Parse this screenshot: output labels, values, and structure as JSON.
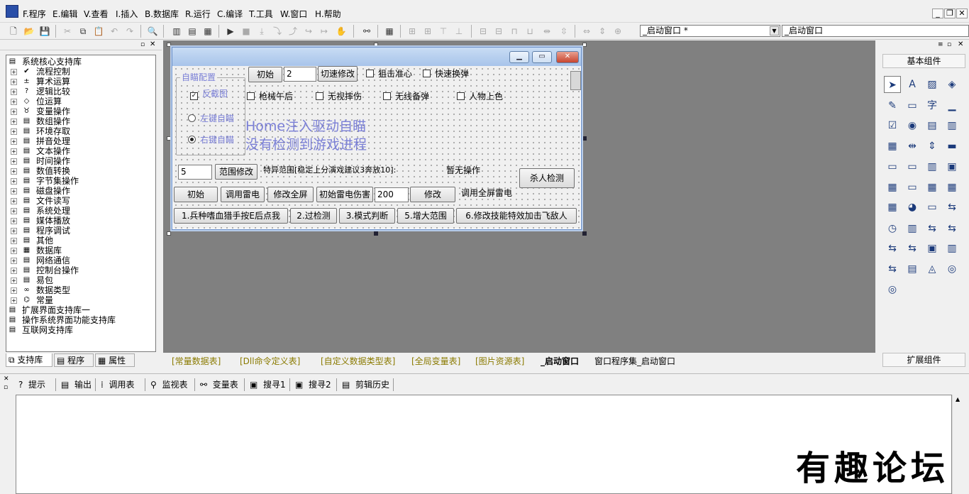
{
  "menubar": {
    "items": [
      "F.程序",
      "E.编辑",
      "V.查看",
      "I.插入",
      "B.数据库",
      "R.运行",
      "C.编译",
      "T.工具",
      "W.窗口",
      "H.帮助"
    ]
  },
  "toolbar": {
    "combo_left": "_启动窗口 *",
    "combo_right": "_启动窗口"
  },
  "tree": {
    "root1": "系统核心支持库",
    "children": [
      "流程控制",
      "算术运算",
      "逻辑比较",
      "位运算",
      "变量操作",
      "数组操作",
      "环境存取",
      "拼音处理",
      "文本操作",
      "时间操作",
      "数值转换",
      "字节集操作",
      "磁盘操作",
      "文件读写",
      "系统处理",
      "媒体播放",
      "程序调试",
      "其他",
      "数据库",
      "网络通信",
      "控制台操作",
      "易包",
      "数据类型",
      "常量"
    ],
    "root2": "扩展界面支持库一",
    "root3": "操作系统界面功能支持库",
    "root4": "互联网支持库"
  },
  "left_tabs": [
    "支持库",
    "程序",
    "属性"
  ],
  "form": {
    "group_title": "自瞄配置",
    "check_fanjietu": "反截图",
    "radio_left": "左键自瞄",
    "radio_right": "右键自瞄",
    "btn_init1": "初始",
    "edit_speed": "2",
    "btn_speed": "切速修改",
    "chk_juji": "狙击准心",
    "chk_kuaisu": "快速换弹",
    "chk_qiangxie": "枪械午后",
    "chk_wushi": "无视摔伤",
    "chk_wuxian": "无线备弹",
    "chk_renwu": "人物上色",
    "status_line1": "Home注入驱动自瞄",
    "status_line2": "没有检测到游戏进程",
    "edit_range": "5",
    "btn_range": "范围修改",
    "range_note": "特异范围[稳定上分演戏建议3奔放10]:",
    "no_op": "暂无操作",
    "btn_kill": "杀人检测",
    "btn_init2": "初始",
    "btn_call_thunder": "调用雷电",
    "btn_full_screen": "修改全屏",
    "btn_init_thunder": "初始雷电伤害",
    "edit_damage": "200",
    "btn_modify": "修改",
    "lbl_full_thunder": "调用全屏雷电",
    "btn_step1": "1.兵种嗜血猎手按E后点我",
    "btn_step2": "2.过检测",
    "btn_step3": "3.模式判断",
    "btn_step5": "5.增大范围",
    "btn_step6": "6.修改技能特效加击飞敌人"
  },
  "right_panel": {
    "title_basic": "基本组件",
    "title_ext": "扩展组件"
  },
  "doc_tabs": [
    "[常量数据表]",
    "[Dll命令定义表]",
    "[自定义数据类型表]",
    "[全局变量表]",
    "[图片资源表]",
    "_启动窗口",
    "窗口程序集_启动窗口"
  ],
  "bottom_tabs": [
    "提示",
    "输出",
    "调用表",
    "监视表",
    "变量表",
    "搜寻1",
    "搜寻2",
    "剪辑历史"
  ],
  "watermark": "有趣论坛",
  "colors": {
    "work_bg": "#808080",
    "status_text": "#7a7fd6",
    "active_tab": "#000000"
  }
}
